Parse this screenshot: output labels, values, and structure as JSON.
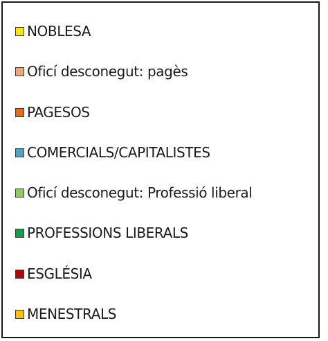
{
  "chart_data": {
    "type": "legend",
    "legend": [
      {
        "label": "NOBLESA",
        "color": "#ffe600"
      },
      {
        "label": "Oficí desconegut: pagès",
        "color": "#f4a571"
      },
      {
        "label": "PAGESOS",
        "color": "#e46c16"
      },
      {
        "label": "COMERCIALS/CAPITALISTES",
        "color": "#4aa5c8"
      },
      {
        "label": "Oficí desconegut: Professió liberal",
        "color": "#8ccc5a"
      },
      {
        "label": "PROFESSIONS LIBERALS",
        "color": "#11a04b"
      },
      {
        "label": "ESGLÉSIA",
        "color": "#c00000"
      },
      {
        "label": "MENESTRALS",
        "color": "#ffc000"
      }
    ]
  }
}
